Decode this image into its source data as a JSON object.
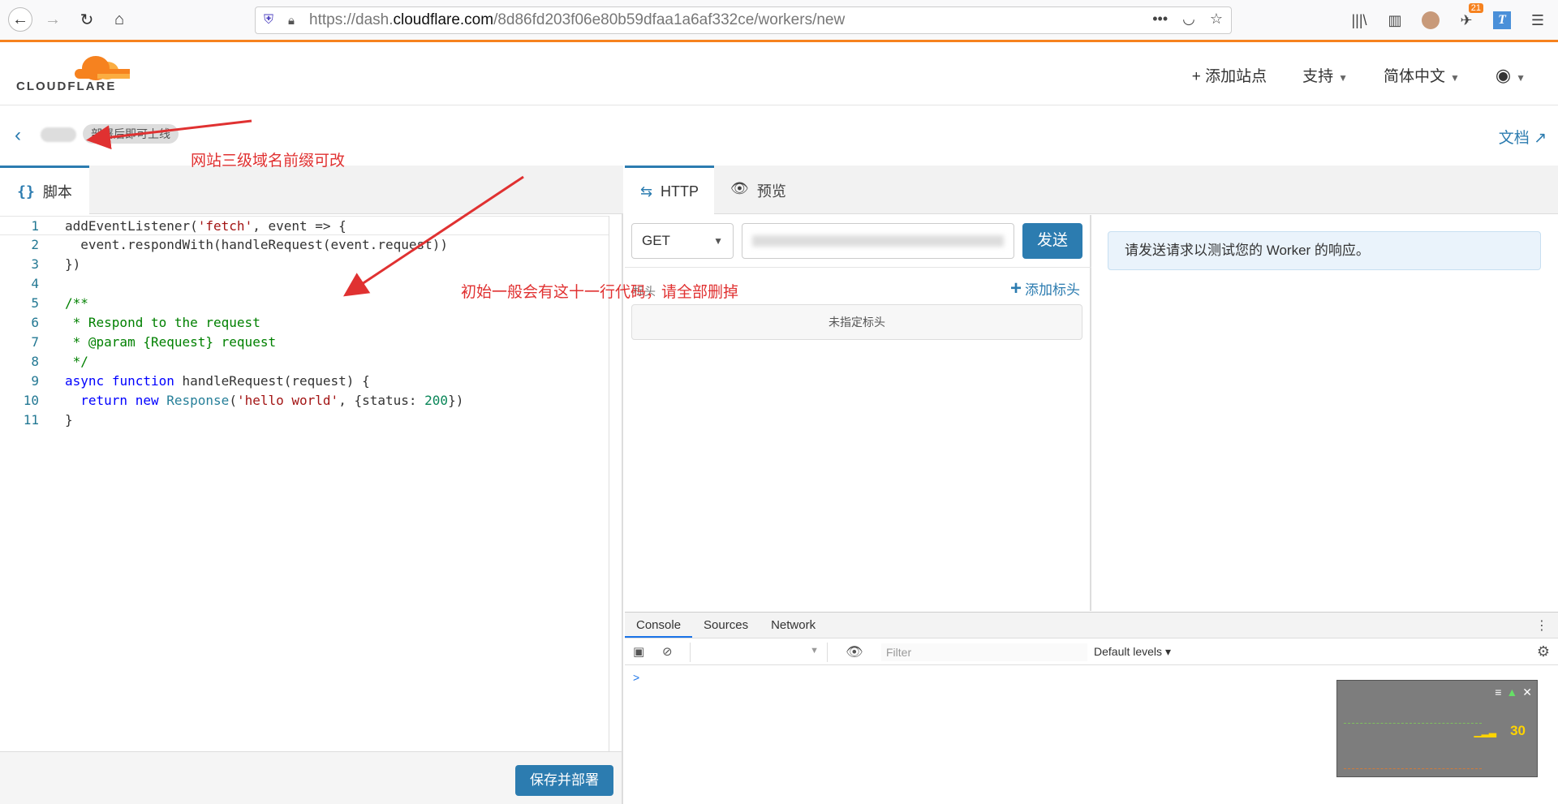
{
  "browser": {
    "url_prefix": "https://dash.",
    "url_host": "cloudflare.com",
    "url_path": "/8d86fd203f06e80b59dfaa1a6af332ce/workers/new",
    "badge_count": "21",
    "t_icon_label": "T"
  },
  "header": {
    "logo_text": "CLOUDFLARE",
    "add_site": "+ 添加站点",
    "support": "支持",
    "language": "简体中文"
  },
  "subheader": {
    "worker_name": "部署后即可上线",
    "docs": "文档"
  },
  "annotations": {
    "subdomain_note": "网站三级域名前缀可改",
    "code_note": "初始一般会有这十一行代码，请全部删掉"
  },
  "editor": {
    "tab_label": "脚本",
    "tab_braces": "{}",
    "line_numbers": [
      "1",
      "2",
      "3",
      "4",
      "5",
      "6",
      "7",
      "8",
      "9",
      "10",
      "11"
    ],
    "save_button": "保存并部署"
  },
  "http": {
    "tab_http": "HTTP",
    "tab_preview": "预览",
    "method": "GET",
    "send": "发送",
    "headers_label": "标头",
    "add_header": "添加标头",
    "no_headers": "未指定标头",
    "response_message": "请发送请求以测试您的 Worker 的响应。"
  },
  "devtools": {
    "tabs": [
      "Console",
      "Sources",
      "Network"
    ],
    "filter_placeholder": "Filter",
    "levels": "Default levels",
    "prompt": ">",
    "fps_value": "30"
  },
  "colors": {
    "accent": "#2c7cb0",
    "cf_orange": "#f6821f",
    "annotation": "#e03131"
  }
}
